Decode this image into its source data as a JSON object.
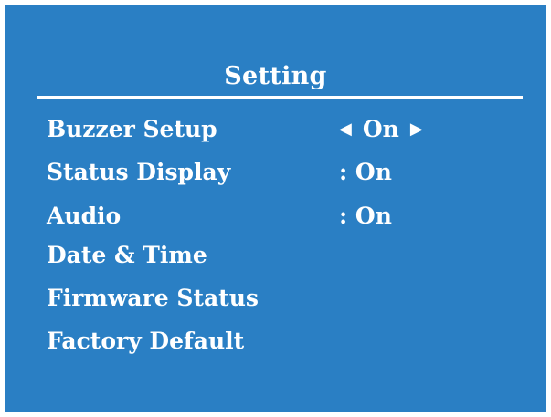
{
  "colors": {
    "background": "#2a7fc4",
    "text": "#ffffff",
    "border": "#ffffff"
  },
  "title": "Setting",
  "menu": [
    {
      "label": "Buzzer Setup",
      "value": "On",
      "left_arrow_icon": "triangle-left-icon",
      "right_arrow_icon": "triangle-right-icon"
    },
    {
      "label": "Status Display",
      "value": ": On"
    },
    {
      "label": "Audio",
      "value": ": On"
    },
    {
      "label": "Date & Time"
    },
    {
      "label": "Firmware Status"
    },
    {
      "label": "Factory Default"
    }
  ]
}
